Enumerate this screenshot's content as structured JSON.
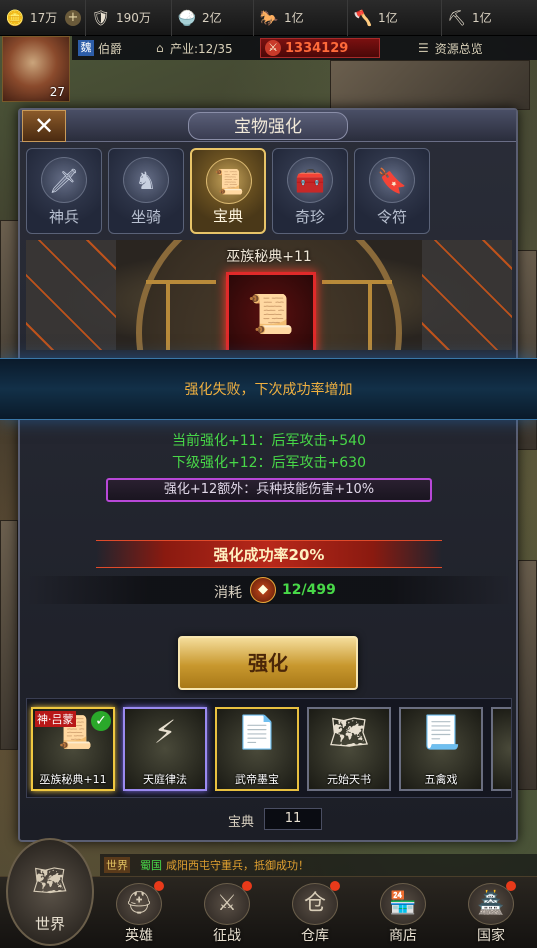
{
  "resources": [
    {
      "icon": "coin-stack-icon",
      "glyph": "🪙",
      "value": "17万"
    },
    {
      "icon": "plus-icon",
      "glyph": "+",
      "value": ""
    },
    {
      "icon": "shield-icon",
      "glyph": "🛡",
      "value": "190万"
    },
    {
      "icon": "food-icon",
      "glyph": "🍚",
      "value": "2亿"
    },
    {
      "icon": "horse-icon",
      "glyph": "🐎",
      "value": "1亿"
    },
    {
      "icon": "axe-icon",
      "glyph": "🪓",
      "value": "1亿"
    },
    {
      "icon": "ore-icon",
      "glyph": "⛏",
      "value": "1亿"
    }
  ],
  "player": {
    "level": "27",
    "title_badge": "魏",
    "title": "伯爵",
    "industry": "产业:12/35",
    "power": "1334129",
    "overview": "资源总览"
  },
  "panel": {
    "title": "宝物强化",
    "close": "✕"
  },
  "tabs": [
    {
      "label": "神兵",
      "glyph": "🗡",
      "active": false
    },
    {
      "label": "坐骑",
      "glyph": "♞",
      "active": false
    },
    {
      "label": "宝典",
      "glyph": "📜",
      "active": true
    },
    {
      "label": "奇珍",
      "glyph": "🧰",
      "active": false
    },
    {
      "label": "令符",
      "glyph": "🔖",
      "active": false
    }
  ],
  "treasure": {
    "name": "巫族秘典+11",
    "glyph": "📜"
  },
  "fail_message": "强化失败，下次成功率增加",
  "stats": {
    "current": "当前强化+11：后军攻击+540",
    "next": "下级强化+12：后军攻击+630",
    "bonus": "强化+12额外：兵种技能伤害+10%",
    "rate": "强化成功率20%",
    "cost_label": "消耗",
    "cost_value": "12/499"
  },
  "enhance_button": "强化",
  "items": [
    {
      "label": "巫族秘典+11",
      "glyph": "📜",
      "tag": "神·吕蒙"
    },
    {
      "label": "天庭律法",
      "glyph": "⚡"
    },
    {
      "label": "武帝墨宝",
      "glyph": "📄"
    },
    {
      "label": "元始天书",
      "glyph": "🗺"
    },
    {
      "label": "五禽戏",
      "glyph": "📃"
    }
  ],
  "count": {
    "label": "宝典",
    "value": "11"
  },
  "chat": {
    "tag": "世界",
    "faction": "蜀国",
    "message": "咸阳西屯守重兵，抵御成功！"
  },
  "nav": [
    {
      "label": "世界",
      "glyph": "🗺"
    },
    {
      "label": "英雄",
      "glyph": "⛑"
    },
    {
      "label": "征战",
      "glyph": "⚔"
    },
    {
      "label": "仓库",
      "glyph": "仓"
    },
    {
      "label": "商店",
      "glyph": "🏪"
    },
    {
      "label": "国家",
      "glyph": "🏯"
    }
  ],
  "colors": {
    "accent_gold": "#e8c468",
    "success_green": "#48d848",
    "fail_orange": "#f0b040",
    "power_red": "#ff6a3a"
  }
}
